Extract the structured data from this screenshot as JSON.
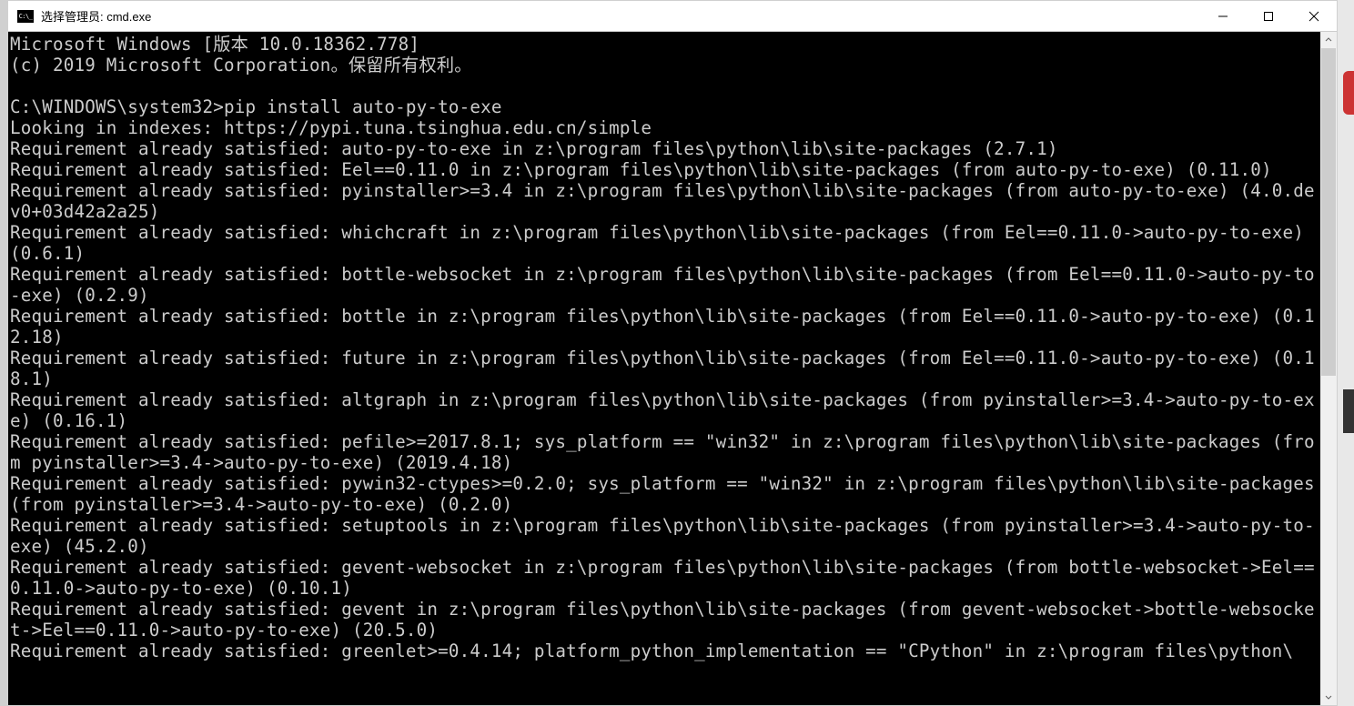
{
  "window": {
    "title": "选择管理员: cmd.exe"
  },
  "terminal": {
    "header1": "Microsoft Windows [版本 10.0.18362.778]",
    "header2": "(c) 2019 Microsoft Corporation。保留所有权利。",
    "prompt": "C:\\WINDOWS\\system32>",
    "command": "pip install auto-py-to-exe",
    "lines": [
      "Looking in indexes: https://pypi.tuna.tsinghua.edu.cn/simple",
      "Requirement already satisfied: auto-py-to-exe in z:\\program files\\python\\lib\\site-packages (2.7.1)",
      "Requirement already satisfied: Eel==0.11.0 in z:\\program files\\python\\lib\\site-packages (from auto-py-to-exe) (0.11.0)",
      "Requirement already satisfied: pyinstaller>=3.4 in z:\\program files\\python\\lib\\site-packages (from auto-py-to-exe) (4.0.dev0+03d42a2a25)",
      "Requirement already satisfied: whichcraft in z:\\program files\\python\\lib\\site-packages (from Eel==0.11.0->auto-py-to-exe) (0.6.1)",
      "Requirement already satisfied: bottle-websocket in z:\\program files\\python\\lib\\site-packages (from Eel==0.11.0->auto-py-to-exe) (0.2.9)",
      "Requirement already satisfied: bottle in z:\\program files\\python\\lib\\site-packages (from Eel==0.11.0->auto-py-to-exe) (0.12.18)",
      "Requirement already satisfied: future in z:\\program files\\python\\lib\\site-packages (from Eel==0.11.0->auto-py-to-exe) (0.18.1)",
      "Requirement already satisfied: altgraph in z:\\program files\\python\\lib\\site-packages (from pyinstaller>=3.4->auto-py-to-exe) (0.16.1)",
      "Requirement already satisfied: pefile>=2017.8.1; sys_platform == \"win32\" in z:\\program files\\python\\lib\\site-packages (from pyinstaller>=3.4->auto-py-to-exe) (2019.4.18)",
      "Requirement already satisfied: pywin32-ctypes>=0.2.0; sys_platform == \"win32\" in z:\\program files\\python\\lib\\site-packages (from pyinstaller>=3.4->auto-py-to-exe) (0.2.0)",
      "Requirement already satisfied: setuptools in z:\\program files\\python\\lib\\site-packages (from pyinstaller>=3.4->auto-py-to-exe) (45.2.0)",
      "Requirement already satisfied: gevent-websocket in z:\\program files\\python\\lib\\site-packages (from bottle-websocket->Eel==0.11.0->auto-py-to-exe) (0.10.1)",
      "Requirement already satisfied: gevent in z:\\program files\\python\\lib\\site-packages (from gevent-websocket->bottle-websocket->Eel==0.11.0->auto-py-to-exe) (20.5.0)",
      "Requirement already satisfied: greenlet>=0.4.14; platform_python_implementation == \"CPython\" in z:\\program files\\python\\"
    ]
  }
}
